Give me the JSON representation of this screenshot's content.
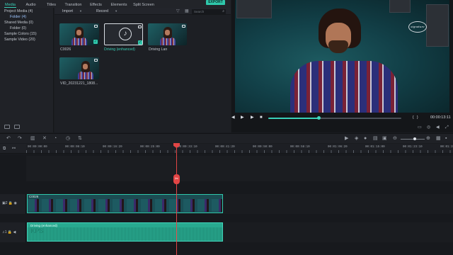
{
  "tabs": [
    {
      "label": "Media",
      "active": true
    },
    {
      "label": "Audio",
      "active": false
    },
    {
      "label": "Titles",
      "active": false
    },
    {
      "label": "Transition",
      "active": false
    },
    {
      "label": "Effects",
      "active": false
    },
    {
      "label": "Elements",
      "active": false
    },
    {
      "label": "Split Screen",
      "active": false
    }
  ],
  "export_label": "EXPORT",
  "folders": {
    "items": [
      "Project Media (4)",
      "Folder (4)",
      "Shared Media (0)",
      "Folder (0)",
      "Sample Colors (15)",
      "Sample Video (20)"
    ],
    "selected_index": 1
  },
  "media_toolbar": {
    "import_label": "Import",
    "record_label": "Record",
    "search_placeholder": "Search"
  },
  "media_items": [
    {
      "name": "C0026",
      "kind": "video",
      "selected": false
    },
    {
      "name": "Driving (enhanced)",
      "kind": "audio",
      "selected": true
    },
    {
      "name": "Driving Lan",
      "kind": "video",
      "selected": false
    },
    {
      "name": "VID_20231221_1808...",
      "kind": "video",
      "selected": false
    }
  ],
  "preview": {
    "timecode": "00:00:13:11",
    "progress_fraction": 0.38
  },
  "ruler": {
    "labels": [
      "00:00:00:00",
      "00:00:08:10",
      "00:00:16:20",
      "00:00:25:00",
      "00:00:33:10",
      "00:00:41:20",
      "00:00:50:00",
      "00:00:58:10",
      "00:01:06:20",
      "00:01:15:00",
      "00:01:23:10",
      "00:01:31:2"
    ]
  },
  "tracks": {
    "video_track_label": "2",
    "audio_track_label": "1",
    "video_clip_name": "C0026",
    "audio_clip_name": "Driving (enhanced)",
    "audio_clip_watermark": "KPS"
  },
  "zoom_fraction": 0.6,
  "colors": {
    "accent": "#39d0b7",
    "playhead": "#e24545",
    "audio_clip": "#28a98f"
  }
}
